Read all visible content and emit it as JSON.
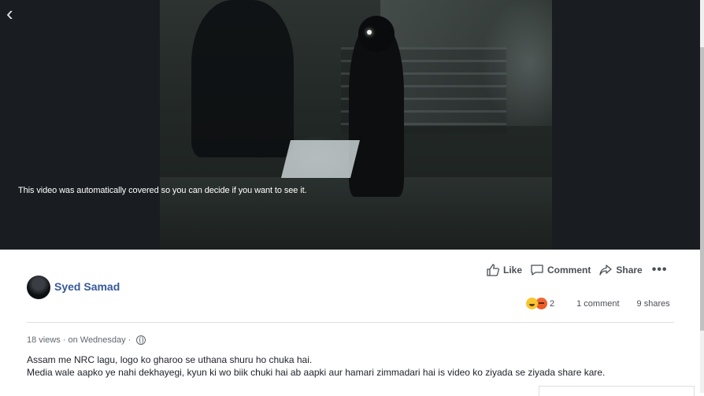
{
  "video": {
    "back_icon": "chevron-left-icon",
    "notice": "This video was automatically covered so you can decide if you want to see it."
  },
  "actions": {
    "like": "Like",
    "comment": "Comment",
    "share": "Share",
    "more": "•••"
  },
  "post": {
    "author": "Syed Samad",
    "reaction_count": "2",
    "comments": "1 comment",
    "shares": "9 shares",
    "views": "18 views",
    "separator": "·",
    "date": "on Wednesday",
    "privacy_icon": "globe-icon",
    "caption_line1": "Assam me NRC lagu, logo ko gharoo se uthana shuru ho chuka hai.",
    "caption_line2": "Media wale aapko ye nahi dekhayegi, kyun ki wo biik chuki hai ab aapki aur hamari zimmadari hai is video ko ziyada se ziyada share kare."
  },
  "colors": {
    "link": "#365899",
    "reaction_haha": "#f7c631",
    "reaction_angry": "#e9581f"
  }
}
